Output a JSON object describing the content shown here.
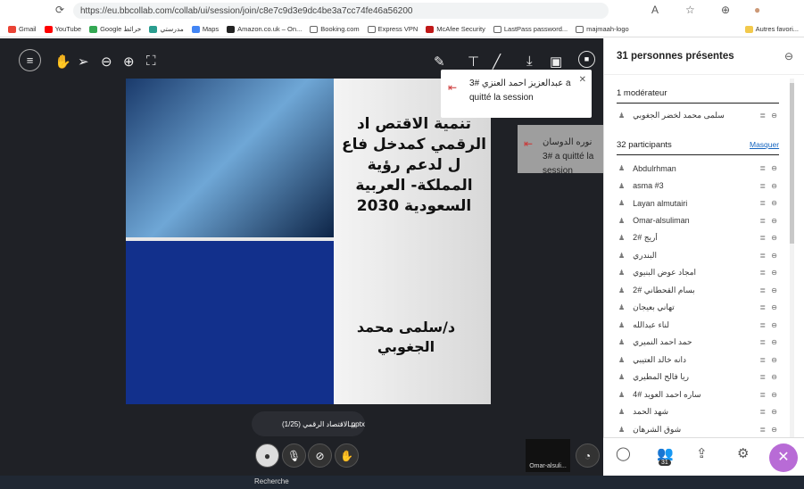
{
  "browser": {
    "url": "https://eu.bbcollab.com/collab/ui/session/join/c8e7c9d3e9dc4be3a7cc74fe46a56200",
    "bookmarks": [
      "Gmail",
      "YouTube",
      "Google خرائط",
      "مدرستي",
      "Maps",
      "Amazon.co.uk – On...",
      "Booking.com",
      "Express VPN",
      "McAfee Security",
      "LastPass password...",
      "majmaah-logo"
    ],
    "other_bookmarks": "Autres favori..."
  },
  "slide": {
    "title": "تنمية الاقتص اد الرقمي كمدخل فاع ل لدعم رؤية المملكة- العربية السعودية 2030",
    "author": "د/سلمى محمد الجغوبي"
  },
  "notifications": [
    {
      "text": "عبدالعزيز احمد العنزي #3 a quitté la session"
    },
    {
      "text": "نوره الدوسان #3 a quitté la session"
    }
  ],
  "pager": {
    "label": "(1/25)  الاقتصاد الرقمي.pptx"
  },
  "cam_user": "Omar-alsuli...",
  "panel": {
    "title": "31 personnes présentes",
    "moderators_header": "1 modérateur",
    "moderator": "سلمى محمد لخضر الجغوبي",
    "participants_header": "32 participants",
    "hide_label": "Masquer",
    "participants": [
      "Abdulrhman",
      "asma #3",
      "Layan almutairi",
      "Omar-alsuliman",
      "أريج #2",
      "البندري",
      "امجاد عوض البنيوي",
      "بسام القحطاني #2",
      "تهاني بعيجان",
      "لناء عبدالله",
      "حمد احمد النميري",
      "دانه خالد العتيبي",
      "ريا فالح المطيري",
      "ساره احمد العويد #4",
      "شهد الحمد",
      "شوق الشرهان"
    ],
    "badge_count": "31"
  },
  "taskbar": {
    "search": "Recherche"
  }
}
